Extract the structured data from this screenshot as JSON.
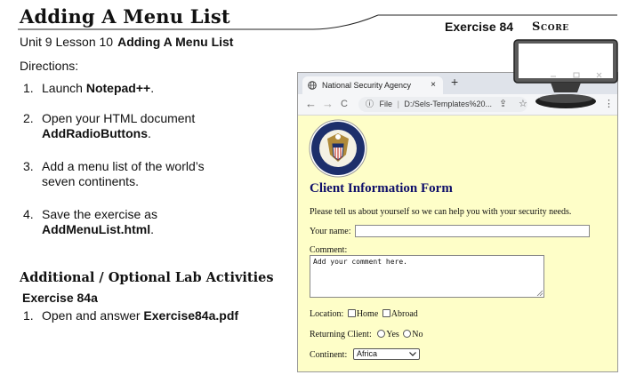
{
  "header": {
    "title": "Adding A Menu List",
    "exercise": "Exercise 84",
    "score": "Score"
  },
  "unit": {
    "prefix": "Unit 9 Lesson 10",
    "lesson_title": "Adding A Menu List"
  },
  "directions_label": "Directions:",
  "steps": [
    {
      "num": "1.",
      "text": "Launch ",
      "bold": "Notepad++",
      "after": "."
    },
    {
      "num": "2.",
      "text": "Open your HTML document",
      "bold": "AddRadioButtons",
      "after": "."
    },
    {
      "num": "3.",
      "line1": "Add a menu list of the world’s",
      "line2": "seven continents."
    },
    {
      "num": "4.",
      "text": "Save the exercise as",
      "bold": "AddMenuList.html",
      "after": "."
    }
  ],
  "additional": {
    "heading": "Additional / Optional Lab Activities",
    "exercise": "Exercise 84a",
    "step_num": "1.",
    "step_text": "Open and answer ",
    "step_bold": "Exercise84a.pdf"
  },
  "browser": {
    "tab_title": "National Security Agency",
    "tab_close": "×",
    "new_tab": "+",
    "address_prefix": "File",
    "address": "D:/Sels-Templates%20...",
    "nav_back": "←",
    "nav_forward": "→",
    "nav_reload": "C",
    "info_icon": "ⓘ",
    "share_icon": "⇪",
    "star_icon": "☆",
    "menu_icon": "⋮"
  },
  "form": {
    "title": "Client Information Form",
    "intro": "Please tell us about yourself so we can help you with your security needs.",
    "name_label": "Your name:",
    "comment_label": "Comment:",
    "comment_value": "Add your comment here.",
    "location_label": "Location:",
    "location_options": [
      "Home",
      "Abroad"
    ],
    "returning_label": "Returning Client:",
    "returning_options": [
      "Yes",
      "No"
    ],
    "continent_label": "Continent:",
    "continent_value": "Africa"
  },
  "icons": {
    "globe": "globe-icon",
    "seal": "nsa-seal-icon",
    "monitor": "monitor-icon"
  },
  "colors": {
    "page_background": "#fefec8",
    "form_title": "#10106a",
    "tab_bar": "#dfe3ea"
  }
}
